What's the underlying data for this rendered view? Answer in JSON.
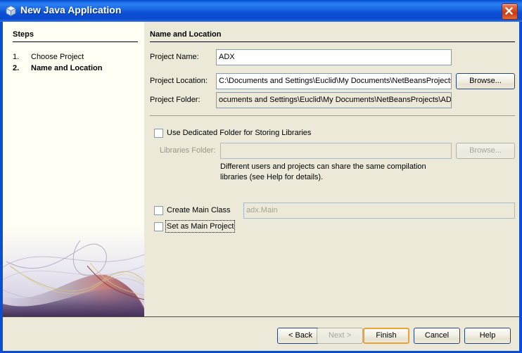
{
  "window": {
    "title": "New Java Application",
    "icon": "cube-icon",
    "close_label": "Close",
    "titlebar_color": "#0a50d0",
    "content_bg": "#ece9d8",
    "sidebar_bg": "#fffff4"
  },
  "sidebar": {
    "heading": "Steps",
    "steps": [
      {
        "number": "1.",
        "label": "Choose Project",
        "current": false
      },
      {
        "number": "2.",
        "label": "Name and Location",
        "current": true
      }
    ]
  },
  "content": {
    "heading": "Name and Location",
    "fields": [
      {
        "label": "Project Name:",
        "value": "ADX",
        "placeholder": "",
        "state": "editable"
      },
      {
        "label": "Project Location:",
        "value": "C:\\Documents and Settings\\Euclid\\My Documents\\NetBeansProjects",
        "placeholder": "",
        "state": "editable"
      },
      {
        "label": "Project Folder:",
        "value": "ocuments and Settings\\Euclid\\My Documents\\NetBeansProjects\\ADX",
        "placeholder": "",
        "state": "readonly"
      }
    ],
    "browse_location_label": "Browse...",
    "dedicated_folder": {
      "label": "Use Dedicated Folder for Storing Libraries",
      "checked": false
    },
    "libraries_folder": {
      "label": "Libraries Folder:",
      "value": "",
      "state": "disabled",
      "browse_label": "Browse..."
    },
    "help_text": "Different users and projects can share the same compilation\nlibraries (see Help for details).",
    "create_main_class": {
      "label": "Create Main Class",
      "checked": false,
      "value": "adx.Main",
      "state": "disabled"
    },
    "set_as_main_project": {
      "label": "Set as Main Project",
      "checked": false,
      "focused": true
    }
  },
  "buttons": {
    "back": {
      "label": "< Back",
      "state": "enabled"
    },
    "next": {
      "label": "Next >",
      "state": "disabled"
    },
    "finish": {
      "label": "Finish",
      "state": "default",
      "focus_color": "#e8a33d"
    },
    "cancel": {
      "label": "Cancel",
      "state": "enabled"
    },
    "help": {
      "label": "Help",
      "state": "enabled"
    }
  }
}
